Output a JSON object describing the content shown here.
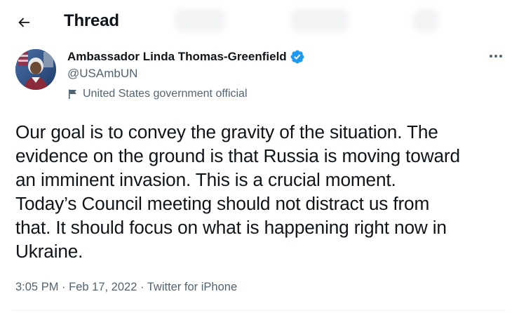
{
  "header": {
    "title": "Thread",
    "back_icon": "arrow-left-icon"
  },
  "author": {
    "display_name": "Ambassador Linda Thomas-Greenfield",
    "handle": "@USAmbUN",
    "verified": true,
    "verified_color": "#1d9bf0",
    "label_icon": "flag-icon",
    "label": "United States government official"
  },
  "tweet": {
    "text": "Our goal is to convey the gravity of the situation. The\nevidence on the ground is that Russia is moving toward\nan imminent invasion. This is a crucial moment.\nToday’s Council meeting should not distract us from\nthat. It should focus on what is happening right now in\nUkraine.",
    "time": "3:05 PM",
    "date": "Feb 17, 2022",
    "source": "Twitter for iPhone",
    "separator": " · "
  },
  "colors": {
    "text": "#0f1419",
    "secondary": "#536471",
    "divider": "#eff3f4"
  }
}
